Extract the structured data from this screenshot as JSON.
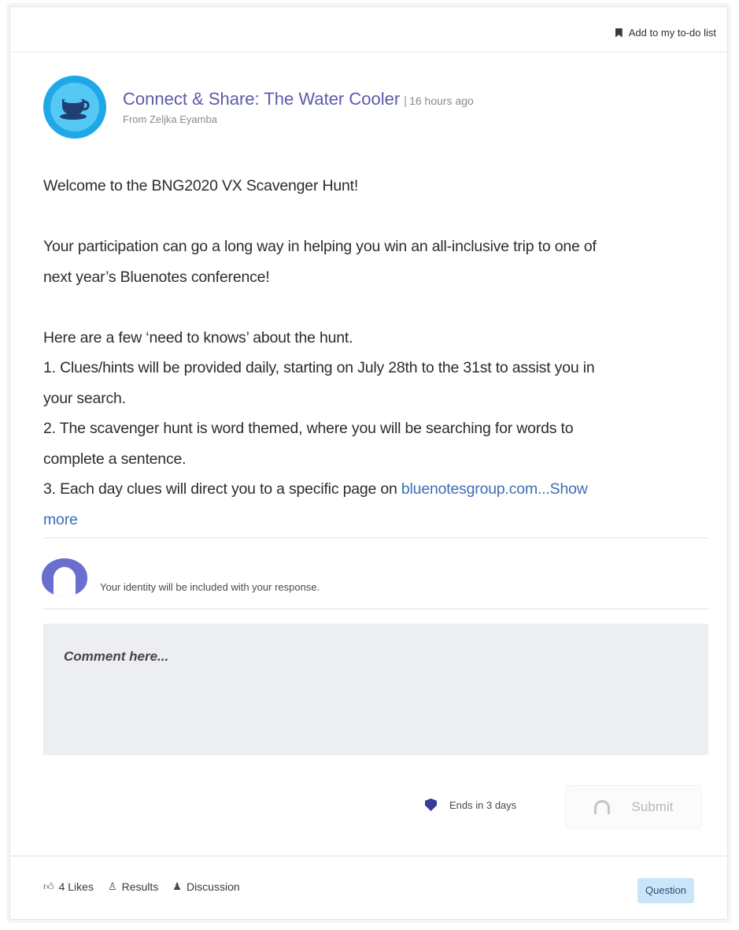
{
  "todo": {
    "label": "Add to my to-do list",
    "icon": "bookmark-icon"
  },
  "post": {
    "channel": "Connect & Share: The Water Cooler",
    "separator": "|",
    "time": "16 hours ago",
    "from": "From Zeljka Eyamba",
    "logo_icon": "coffee-cup-icon"
  },
  "body": {
    "heading": "Welcome to the BNG2020 VX Scavenger Hunt!",
    "intro_line1": "Your participation can go a long way in helping you win an all-inclusive trip to one of",
    "intro_line2": "next year’s Bluenotes conference!",
    "knows": "Here are a few ‘need to knows’ about the hunt.",
    "item1_line1": "1. Clues/hints will be provided daily, starting on July 28th to the 31st to assist you in",
    "item1_line2": "your search.",
    "item2_line1": "2. The scavenger hunt is word themed, where you will be searching for words to",
    "item2_line2": "complete a sentence.",
    "item3_text": "3. Each day clues will direct you to a specific page on ",
    "item3_link": "bluenotesgroup.com",
    "show_more_a": "...Show",
    "show_more_b": "more"
  },
  "identity": {
    "text": "Your identity will be included with your response."
  },
  "comment": {
    "placeholder": "Comment here..."
  },
  "deadline": {
    "text": "Ends in 3 days",
    "icon": "shield-icon"
  },
  "submit": {
    "label": "Submit",
    "icon": "headphones-icon"
  },
  "footer": {
    "likes": "4 Likes",
    "results": "Results",
    "discussion": "Discussion",
    "badge": "Question"
  },
  "colors": {
    "accent": "#5c5aa8",
    "link": "#3d6fb6",
    "logo": "#1fa8e8",
    "badge_bg": "#c9e6f8"
  }
}
